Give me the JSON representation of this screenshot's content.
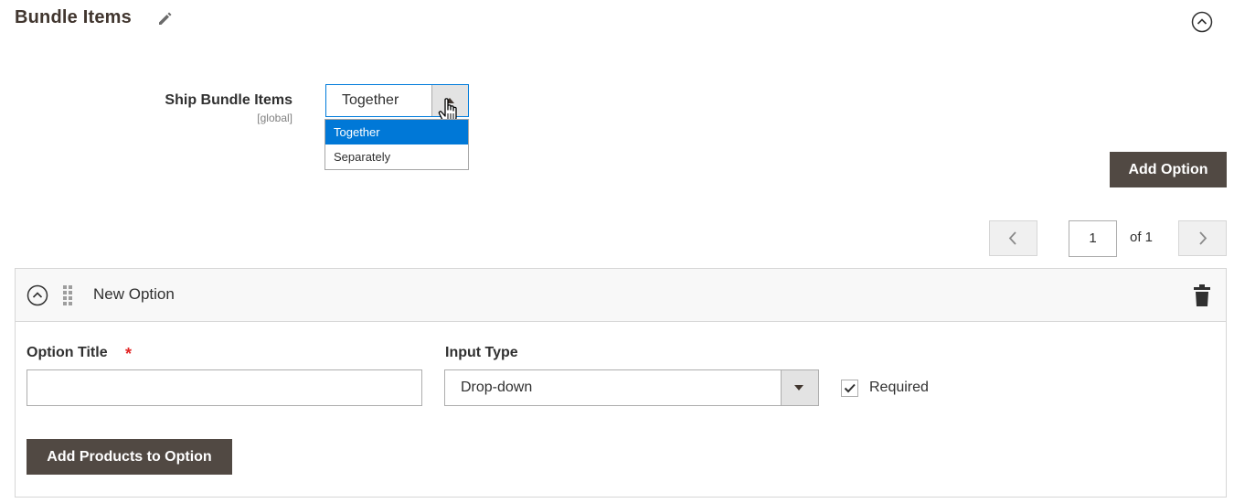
{
  "section": {
    "title": "Bundle Items"
  },
  "ship": {
    "label": "Ship Bundle Items",
    "scope": "[global]",
    "selected": "Together",
    "options": [
      "Together",
      "Separately"
    ]
  },
  "toolbar": {
    "add_option_label": "Add Option"
  },
  "pager": {
    "current_page": "1",
    "of_text": "of 1"
  },
  "option": {
    "name": "New Option",
    "title_label": "Option Title",
    "required_star": "*",
    "title_value": "",
    "input_type_label": "Input Type",
    "input_type_value": "Drop-down",
    "required_label": "Required",
    "required_checked": true,
    "add_products_label": "Add Products to Option"
  },
  "colors": {
    "accent": "#007bdb",
    "button_dark": "#514943",
    "selection": "#0078d7",
    "required": "#e22626"
  }
}
